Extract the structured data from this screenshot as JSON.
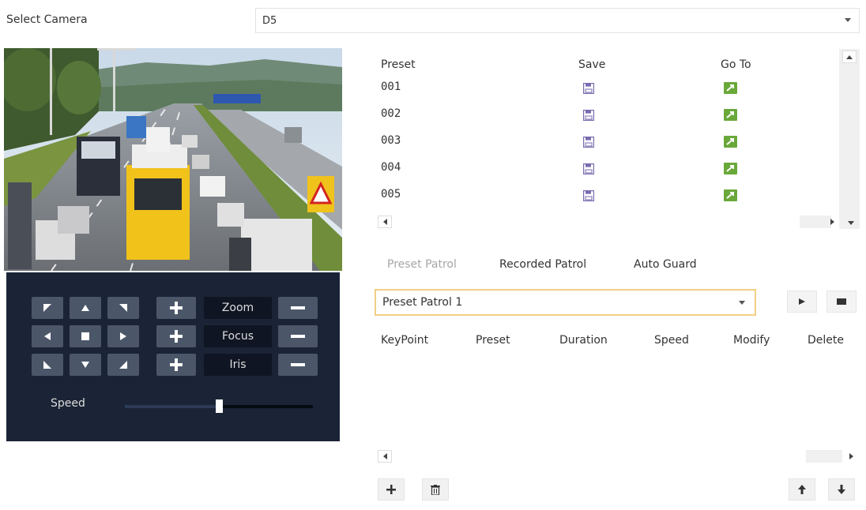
{
  "camera": {
    "label": "Select Camera",
    "value": "D5"
  },
  "ptz": {
    "zoom_label": "Zoom",
    "focus_label": "Focus",
    "iris_label": "Iris",
    "speed_label": "Speed",
    "speed_value": 0.5
  },
  "presets": {
    "headers": {
      "preset": "Preset",
      "save": "Save",
      "goto": "Go To"
    },
    "rows": [
      "001",
      "002",
      "003",
      "004",
      "005"
    ]
  },
  "patrol_tabs": {
    "preset": "Preset Patrol",
    "recorded": "Recorded Patrol",
    "guard": "Auto Guard",
    "active": "preset"
  },
  "patrol": {
    "selected": "Preset Patrol 1",
    "headers": {
      "keypoint": "KeyPoint",
      "preset": "Preset",
      "duration": "Duration",
      "speed": "Speed",
      "modify": "Modify",
      "delete": "Delete"
    }
  },
  "colors": {
    "ptz_bg": "#1b2436",
    "goto_green": "#6aa83a",
    "save_purple": "#7a6bb0",
    "select_highlight": "#f0cf85",
    "inactive_tab": "#a6a6a6"
  },
  "icons": [
    "caret-down-icon",
    "arrow-icon",
    "plus-icon",
    "minus-icon",
    "stop-icon",
    "save-icon",
    "goto-icon",
    "play-icon",
    "trash-icon",
    "arrow-up-icon",
    "arrow-down-icon"
  ]
}
